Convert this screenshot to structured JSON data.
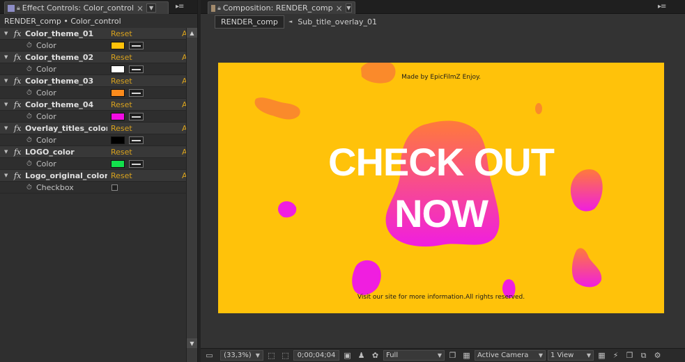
{
  "effect_controls": {
    "tab_title": "Effect Controls: Color_control",
    "tab_swatch_color": "#8d8dc6",
    "path": "RENDER_comp • Color_control",
    "reset_label": "Reset",
    "about_label": "A",
    "effects": [
      {
        "name": "Color_theme_01",
        "param": "Color",
        "type": "color",
        "value": "#ffc20a"
      },
      {
        "name": "Color_theme_02",
        "param": "Color",
        "type": "color",
        "value": "#ffffff"
      },
      {
        "name": "Color_theme_03",
        "param": "Color",
        "type": "color",
        "value": "#fb8b1c"
      },
      {
        "name": "Color_theme_04",
        "param": "Color",
        "type": "color",
        "value": "#f30ce3"
      },
      {
        "name": "Overlay_titles_color",
        "param": "Color",
        "type": "color",
        "value": "#000000"
      },
      {
        "name": "LOGO_color",
        "param": "Color",
        "type": "color",
        "value": "#12e04c"
      },
      {
        "name": "Logo_original_color",
        "param": "Checkbox",
        "type": "checkbox",
        "value": false
      }
    ]
  },
  "composition": {
    "tab_title": "Composition: RENDER_comp",
    "tab_swatch_color": "#a28a6c",
    "breadcrumb_active": "RENDER_comp",
    "breadcrumb_next": "Sub_title_overlay_01",
    "canvas": {
      "top_text": "Made by EpicFilmZ Enjoy.",
      "headline_line1": "CHECK OUT",
      "headline_line2": "NOW",
      "bottom_text": "Visit our site for more information.All rights reserved.",
      "background_color": "#ffc20a",
      "blob_gradient_top": "#ff7a3a",
      "blob_gradient_bottom": "#f01ee0",
      "blob_orange": "#fa8a2b"
    },
    "toolbar": {
      "zoom": "(33,3%)",
      "timecode": "0;00;04;04",
      "resolution": "Full",
      "camera": "Active Camera",
      "views": "1 View"
    }
  },
  "icons": {
    "close": "×",
    "dropdown": "▼",
    "menu": "▸≡",
    "twirl_open": "▼",
    "stopwatch": "⏱",
    "crumb_arrow": "◄",
    "scroll_up": "▲",
    "scroll_down": "▼",
    "camera": "▣",
    "aspect": "▭",
    "region": "⬚",
    "grid": "▦",
    "flowchart": "⧉",
    "fast_previews": "⚡",
    "expand": "❐",
    "reset_exposure": "⚙"
  }
}
